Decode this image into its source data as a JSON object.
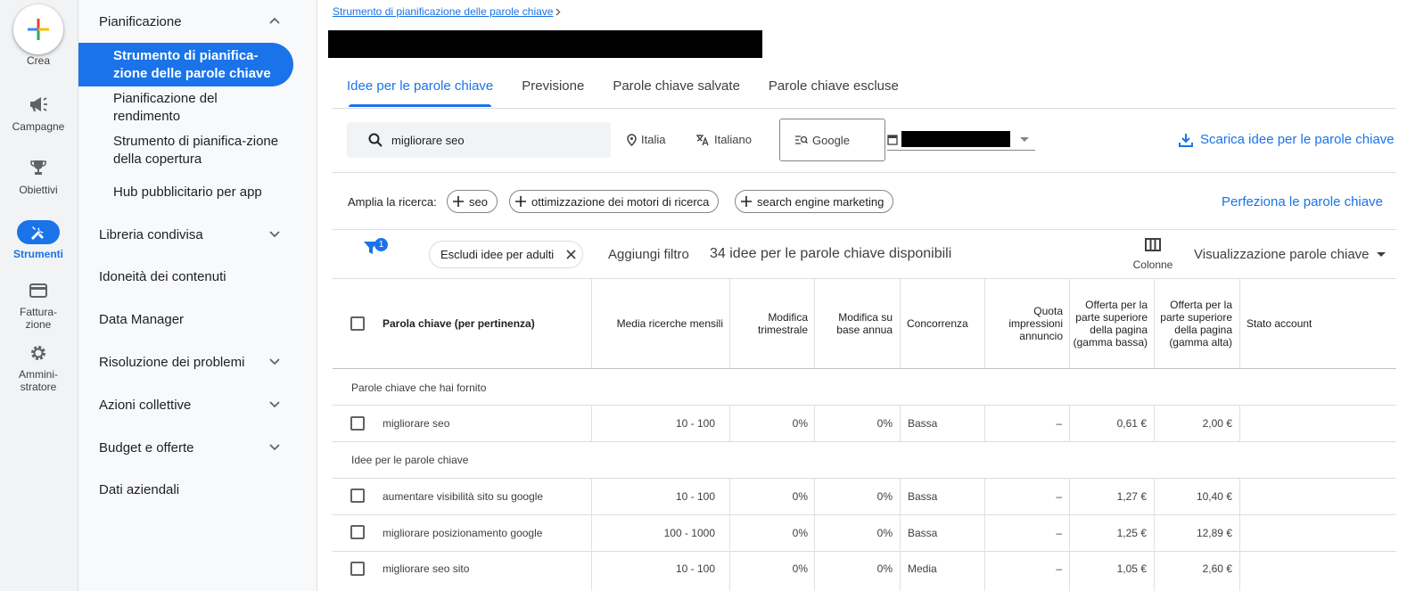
{
  "rail": {
    "create_label": "Crea",
    "items": [
      {
        "label": "Campagne"
      },
      {
        "label": "Obiettivi"
      },
      {
        "label": "Strumenti"
      },
      {
        "label": "Fattura-\nzione"
      },
      {
        "label": "Ammini-\nstratore"
      }
    ]
  },
  "sidebar": {
    "planning": "Pianificazione",
    "sub_items": [
      "Strumento di pianifica-zione delle parole chiave",
      "Pianificazione del rendimento",
      "Strumento di pianifica-zione della copertura",
      "Hub pubblicitario per app"
    ],
    "sections": [
      "Libreria condivisa",
      "Idoneità dei contenuti",
      "Data Manager",
      "Risoluzione dei problemi",
      "Azioni collettive",
      "Budget e offerte",
      "Dati aziendali"
    ]
  },
  "breadcrumb": "Strumento di pianificazione delle parole chiave",
  "tabs": [
    "Idee per le parole chiave",
    "Previsione",
    "Parole chiave salvate",
    "Parole chiave escluse"
  ],
  "search": {
    "value": "migliorare seo"
  },
  "location": "Italia",
  "language": "Italiano",
  "network": "Google",
  "download_label": "Scarica idee per le parole chiave",
  "broaden": {
    "label": "Amplia la ricerca:",
    "chips": [
      "seo",
      "ottimizzazione dei motori di ricerca",
      "search engine marketing"
    ]
  },
  "refine_label": "Perfeziona le parole chiave",
  "filter_count": "1",
  "adult_filter": "Escludi idee per adulti",
  "add_filter": "Aggiungi filtro",
  "available": "34 idee per le parole chiave disponibili",
  "columns_label": "Colonne",
  "view_label": "Visualizzazione parole chiave",
  "table": {
    "headers": [
      "Parola chiave (per pertinenza)",
      "Media ricerche mensili",
      "Modifica trimestrale",
      "Modifica su base annua",
      "Concorrenza",
      "Quota impressioni annuncio",
      "Offerta per la parte superiore della pagina (gamma bassa)",
      "Offerta per la parte superiore della pagina (gamma alta)",
      "Stato account"
    ],
    "group1": "Parole chiave che hai fornito",
    "group2": "Idee per le parole chiave",
    "provided": [
      {
        "kw": "migliorare seo",
        "avg": "10 - 100",
        "q": "0%",
        "y": "0%",
        "comp": "Bassa",
        "share": "–",
        "low": "0,61 €",
        "high": "2,00 €"
      }
    ],
    "ideas": [
      {
        "kw": "aumentare visibilità sito su google",
        "avg": "10 - 100",
        "q": "0%",
        "y": "0%",
        "comp": "Bassa",
        "share": "–",
        "low": "1,27 €",
        "high": "10,40 €"
      },
      {
        "kw": "migliorare posizionamento google",
        "avg": "100 - 1000",
        "q": "0%",
        "y": "0%",
        "comp": "Bassa",
        "share": "–",
        "low": "1,25 €",
        "high": "12,89 €"
      },
      {
        "kw": "migliorare seo sito",
        "avg": "10 - 100",
        "q": "0%",
        "y": "0%",
        "comp": "Media",
        "share": "–",
        "low": "1,05 €",
        "high": "2,60 €"
      }
    ]
  }
}
